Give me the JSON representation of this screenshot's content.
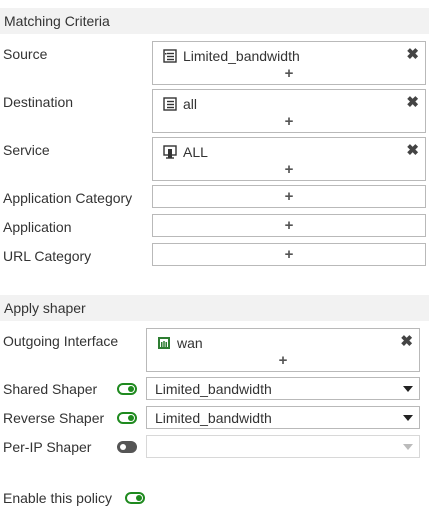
{
  "matching": {
    "header": "Matching Criteria",
    "source": {
      "label": "Source",
      "entry": "Limited_bandwidth",
      "entry_icon": "address-group-icon",
      "add": "+"
    },
    "destination": {
      "label": "Destination",
      "entry": "all",
      "entry_icon": "address-icon",
      "add": "+"
    },
    "service": {
      "label": "Service",
      "entry": "ALL",
      "entry_icon": "service-icon",
      "add": "+"
    },
    "app_category": {
      "label": "Application Category",
      "add": "+"
    },
    "application": {
      "label": "Application",
      "add": "+"
    },
    "url_category": {
      "label": "URL Category",
      "add": "+"
    }
  },
  "shaper": {
    "header": "Apply shaper",
    "outgoing": {
      "label": "Outgoing Interface",
      "entry": "wan",
      "entry_icon": "interface-icon",
      "add": "+"
    },
    "shared": {
      "label": "Shared Shaper",
      "enabled": true,
      "value": "Limited_bandwidth"
    },
    "reverse": {
      "label": "Reverse Shaper",
      "enabled": true,
      "value": "Limited_bandwidth"
    },
    "per_ip": {
      "label": "Per-IP Shaper",
      "enabled": false,
      "value": ""
    }
  },
  "policy": {
    "label": "Enable this policy",
    "enabled": true
  },
  "colors": {
    "toggle_on": "#1f8a1f",
    "toggle_off": "#555555",
    "header_bg": "#f2f2f2",
    "interface_icon": "#2e7d32"
  }
}
